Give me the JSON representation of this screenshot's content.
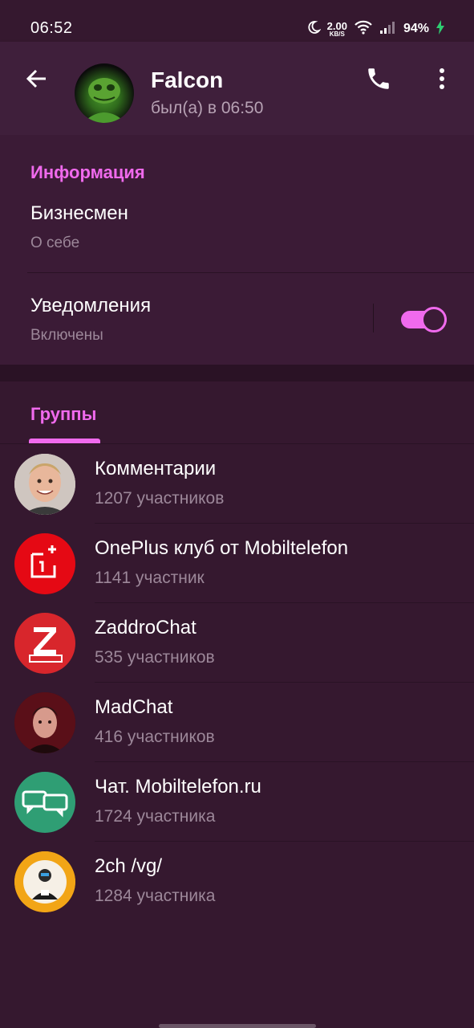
{
  "status_bar": {
    "time": "06:52",
    "net_speed_value": "2.00",
    "net_speed_unit": "KB/S",
    "battery": "94%",
    "icons": [
      "moon-icon",
      "wifi-icon",
      "signal-icon",
      "charging-bolt-icon"
    ]
  },
  "toolbar": {
    "title": "Falcon",
    "subtitle": "был(а) в 06:50",
    "icons": [
      "back-arrow-icon",
      "phone-icon",
      "more-vertical-icon"
    ]
  },
  "info": {
    "header": "Информация",
    "bio_value": "Бизнесмен",
    "bio_label": "О себе",
    "notifications_value": "Уведомления",
    "notifications_label": "Включены",
    "notifications_enabled": true
  },
  "tabs": {
    "groups": "Группы"
  },
  "groups": [
    {
      "name": "Комментарии",
      "count": "1207 участников"
    },
    {
      "name": "OnePlus клуб от Mobiltelefon",
      "count": "1141 участник"
    },
    {
      "name": "ZaddroChat",
      "count": "535 участников"
    },
    {
      "name": "MadChat",
      "count": "416 участников"
    },
    {
      "name": "Чат. Mobiltelefon.ru",
      "count": "1724 участника"
    },
    {
      "name": "2ch /vg/",
      "count": "1284 участника"
    }
  ],
  "colors": {
    "accent": "#f06aed",
    "background": "#35182f",
    "toolbar": "#3f1f3b",
    "secondary_text": "#9c8799",
    "oneplus_red": "#e50914",
    "zaddro_red": "#d8262c",
    "chat_green": "#2f9e74"
  }
}
